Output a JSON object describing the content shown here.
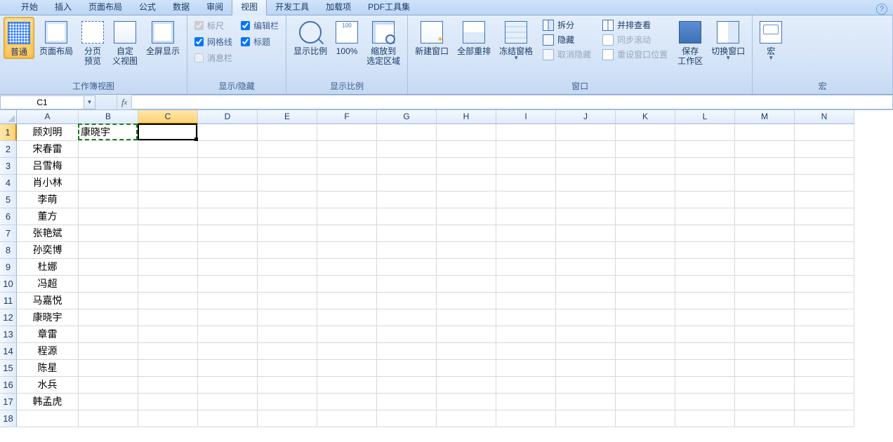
{
  "tabs": {
    "items": [
      "开始",
      "插入",
      "页面布局",
      "公式",
      "数据",
      "审阅",
      "视图",
      "开发工具",
      "加载项",
      "PDF工具集"
    ],
    "active_index": 6
  },
  "ribbon": {
    "group_views": {
      "caption": "工作簿视图",
      "normal": "普通",
      "pagelayout": "页面布局",
      "pagebreak": "分页\n预览",
      "custom": "自定\n义视图",
      "fullscreen": "全屏显示"
    },
    "group_show": {
      "caption": "显示/隐藏",
      "ruler": "标尺",
      "gridlines": "网格线",
      "messagebar": "消息栏",
      "formulabar": "编辑栏",
      "headings": "标题"
    },
    "group_zoom": {
      "caption": "显示比例",
      "zoom": "显示比例",
      "pct100": "100%",
      "zoomsel": "缩放到\n选定区域"
    },
    "group_window": {
      "caption": "窗口",
      "newwin": "新建窗口",
      "arrange": "全部重排",
      "freeze": "冻结窗格",
      "split": "拆分",
      "hide": "隐藏",
      "unhide": "取消隐藏",
      "sidebyside": "并排查看",
      "syncscroll": "同步滚动",
      "resetpos": "重设窗口位置",
      "savews": "保存\n工作区",
      "switchwin": "切换窗口"
    },
    "group_macro": {
      "caption": "宏",
      "macros": "宏"
    }
  },
  "fx": {
    "namebox": "C1",
    "formula": ""
  },
  "columns": [
    "A",
    "B",
    "C",
    "D",
    "E",
    "F",
    "G",
    "H",
    "I",
    "J",
    "K",
    "L",
    "M",
    "N"
  ],
  "rows_count": 18,
  "data_a": [
    "顾刘明",
    "宋春雷",
    "吕雪梅",
    "肖小林",
    "李萌",
    "董方",
    "张艳斌",
    "孙奕博",
    "杜娜",
    "冯超",
    "马嘉悦",
    "康晓宇",
    "章雷",
    "程源",
    "陈星",
    "水兵",
    "韩孟虎"
  ],
  "b1": "康晓宇",
  "selected_col_index": 2,
  "selected_row_index": 0
}
